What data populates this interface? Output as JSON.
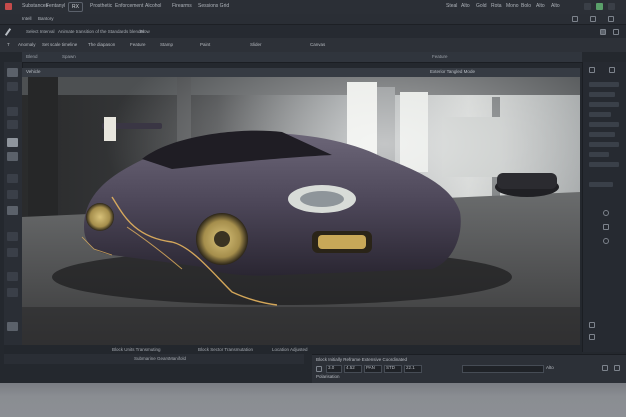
{
  "menubar": {
    "items": [
      "Substances",
      "Fentanyl",
      "Prosthetic",
      "Enforcement",
      "Alcohol",
      "Firearms",
      "Sessions Grid"
    ],
    "active_pill": "RX",
    "right_items": [
      "Steal",
      "Alto",
      "Gold",
      "Rota",
      "Mono",
      "Bolo",
      "Alto",
      "Alto"
    ]
  },
  "menubar2": {
    "items": [
      "Intell",
      "Bantory"
    ]
  },
  "toolbar": {
    "items": [
      "Select Interval",
      "Animate transition of the Standards blender",
      "Blow"
    ]
  },
  "optbar": {
    "items": [
      "T",
      "Anomaly",
      "Set scale timeline",
      "The diapason",
      "Feature",
      "Stamp",
      "Paint",
      "Slider",
      "Canvas"
    ]
  },
  "tabbar": {
    "items": [
      "Blend",
      "Spawn",
      "Feature"
    ]
  },
  "doc_tab": {
    "title": "Vehicle",
    "right": "Exterior Tangled Mode"
  },
  "statusbar": {
    "items": [
      "Block Units Transmuting",
      "Block Sector Transmutation",
      "Location Adjusted"
    ]
  },
  "status2": {
    "items": [
      "Submarine Gears",
      "Manifold"
    ]
  },
  "bottompanel": {
    "line1": "Block Initially Reframe Extensive Coordinated",
    "line2_fields": [
      "3.0",
      "4.52",
      "PAN",
      "STD",
      "22.1"
    ],
    "line3": "Polarisation",
    "end_label": "Alto"
  },
  "colors": {
    "frame": "#24282e",
    "car_body": "#4c4658",
    "wheel": "#b09a56",
    "accent_trace": "#e6b45e"
  },
  "icons": [
    "menu-icon",
    "brush-icon",
    "move-icon",
    "zoom-icon",
    "hand-icon",
    "eye-icon",
    "layers-icon",
    "gear-icon"
  ]
}
